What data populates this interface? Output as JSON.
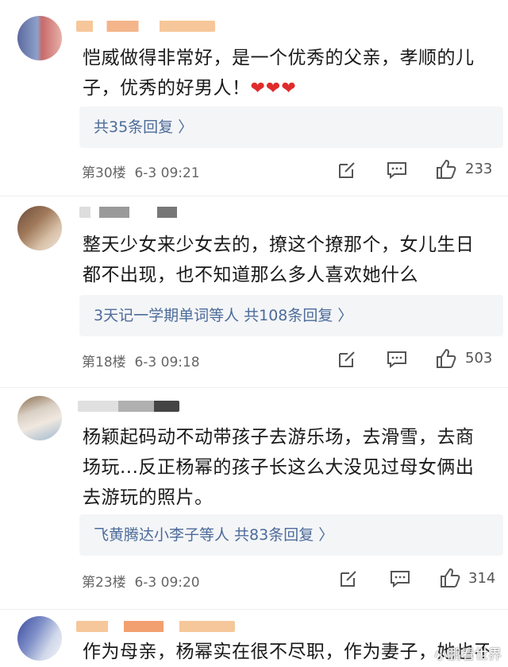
{
  "comments": [
    {
      "content": "恺威做得非常好，是一个优秀的父亲，孝顺的儿子，优秀的好男人！",
      "hearts": "❤❤❤",
      "replies": "共35条回复 〉",
      "floor": "第30楼",
      "time": "6-3 09:21",
      "likes": "233"
    },
    {
      "content": "整天少女来少女去的，撩这个撩那个，女儿生日都不出现，也不知道那么多人喜欢她什么",
      "replies": "3天记一学期单词等人 共108条回复 〉",
      "floor": "第18楼",
      "time": "6-3 09:18",
      "likes": "503"
    },
    {
      "content": "杨颖起码动不动带孩子去游乐场，去滑雪，去商场玩...反正杨幂的孩子长这么大没见过母女俩出去游玩的照片。",
      "replies": "飞黄腾达小李子等人 共83条回复 〉",
      "floor": "第23楼",
      "time": "6-3 09:20",
      "likes": "314"
    },
    {
      "content": "作为母亲，杨幂实在很不尽职，作为妻子，她也不"
    }
  ],
  "watermark": "小鹏看世界",
  "colors": {
    "reply_link": "#4c6b9a",
    "reply_bg": "#f4f5f7",
    "heart": "#e02b2b",
    "meta": "#666666"
  }
}
